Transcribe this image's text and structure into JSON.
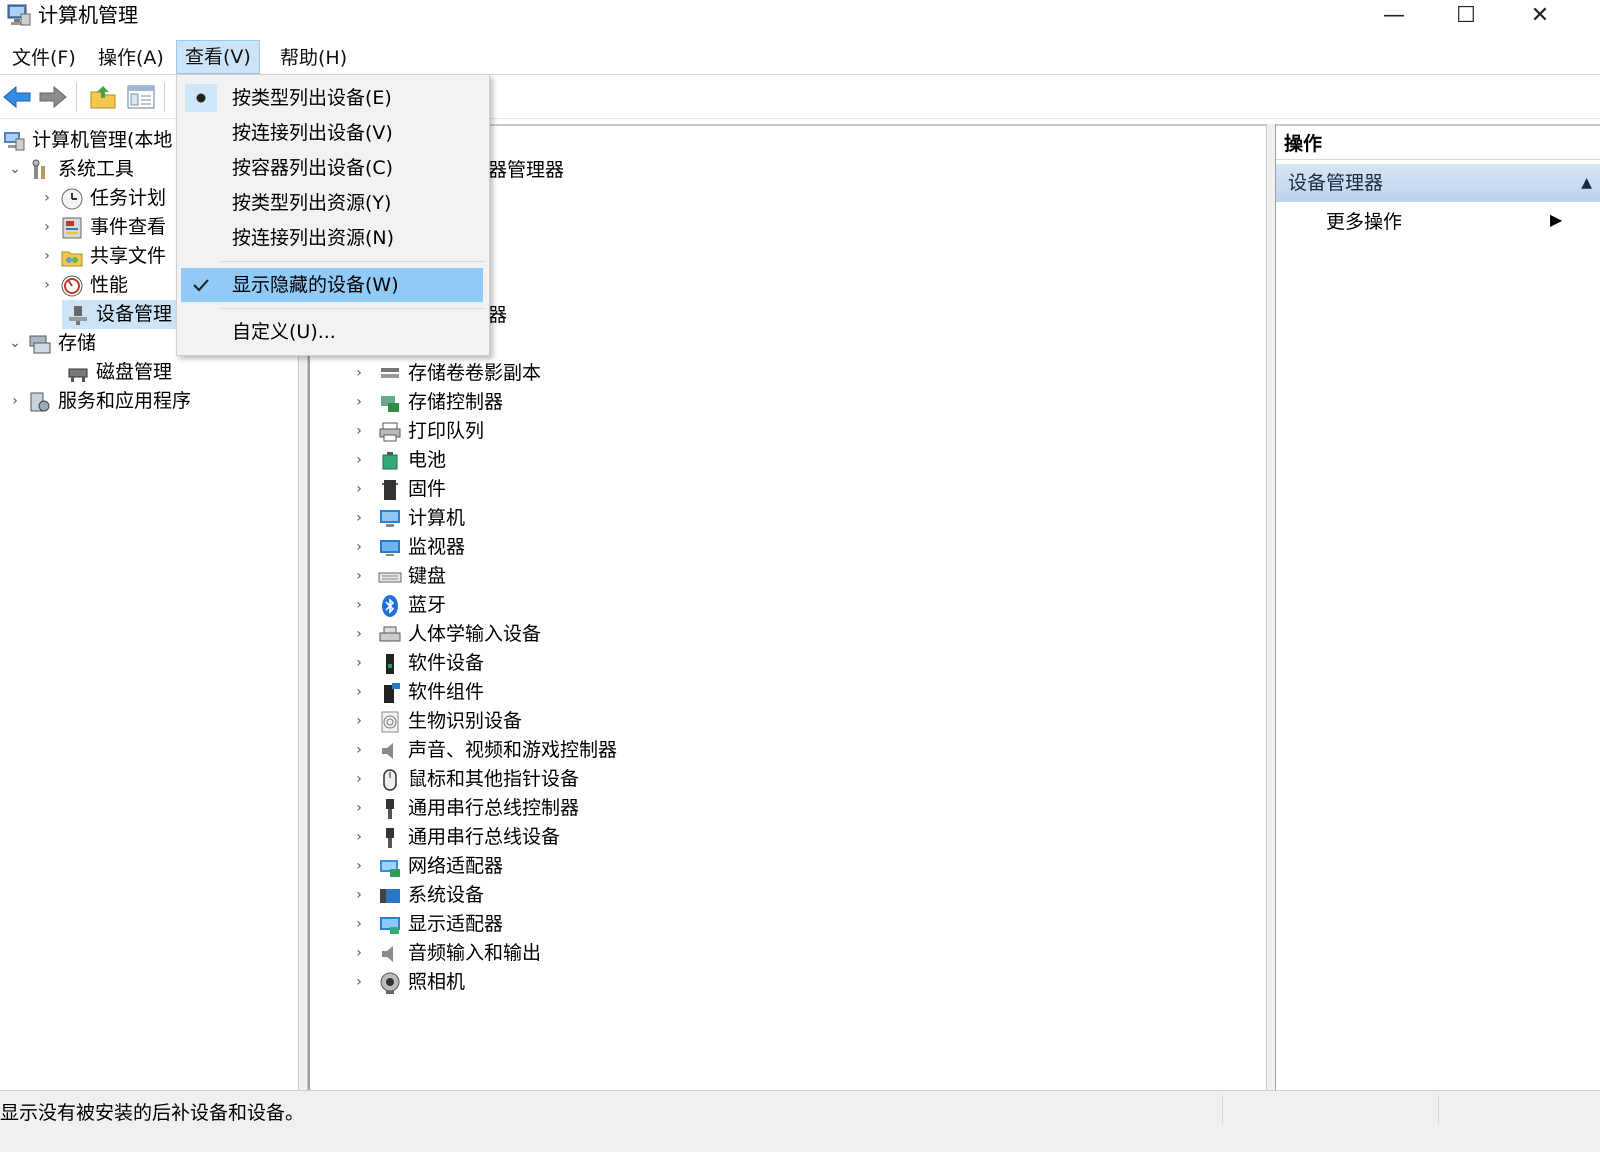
{
  "window": {
    "title": "计算机管理",
    "controls": [
      "—",
      "☐",
      "✕"
    ]
  },
  "menubar": {
    "items": [
      "文件(F)",
      "操作(A)",
      "查看(V)",
      "帮助(H)"
    ],
    "active_index": 2
  },
  "view_menu": {
    "items": [
      {
        "label": "按类型列出设备(E)",
        "mark": "radio",
        "highlighted": false
      },
      {
        "label": "按连接列出设备(V)",
        "mark": "",
        "highlighted": false
      },
      {
        "label": "按容器列出设备(C)",
        "mark": "",
        "highlighted": false
      },
      {
        "label": "按类型列出资源(Y)",
        "mark": "",
        "highlighted": false
      },
      {
        "label": "按连接列出资源(N)",
        "mark": "",
        "highlighted": false
      },
      {
        "label": "显示隐藏的设备(W)",
        "mark": "check",
        "highlighted": true
      },
      {
        "label": "自定义(U)...",
        "mark": "",
        "highlighted": false
      }
    ]
  },
  "left_tree": {
    "root": "计算机管理(本地",
    "system_tools": "系统工具",
    "task_scheduler": "任务计划",
    "event_viewer": "事件查看",
    "shared_folders": "共享文件",
    "performance": "性能",
    "device_manager": "设备管理",
    "storage": "存储",
    "disk_management": "磁盘管理",
    "services_apps": "服务和应用程序"
  },
  "center": {
    "partial_title": "器管理器",
    "partial_item": "器",
    "devices": [
      "存储卷卷影副本",
      "存储控制器",
      "打印队列",
      "电池",
      "固件",
      "计算机",
      "监视器",
      "键盘",
      "蓝牙",
      "人体学输入设备",
      "软件设备",
      "软件组件",
      "生物识别设备",
      "声音、视频和游戏控制器",
      "鼠标和其他指针设备",
      "通用串行总线控制器",
      "通用串行总线设备",
      "网络适配器",
      "系统设备",
      "显示适配器",
      "音频输入和输出",
      "照相机"
    ]
  },
  "action_pane": {
    "header": "操作",
    "section": "设备管理器",
    "more": "更多操作"
  },
  "statusbar": {
    "text": "显示没有被安装的后补设备和设备。"
  }
}
